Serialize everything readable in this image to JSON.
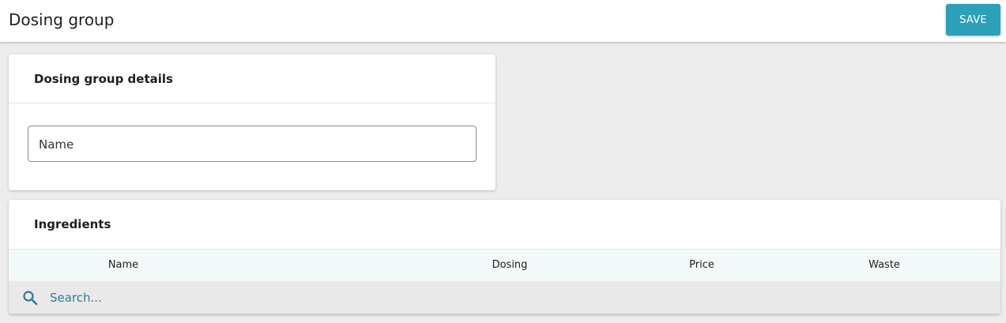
{
  "header": {
    "title": "Dosing group",
    "save_label": "SAVE"
  },
  "details": {
    "title": "Dosing group details",
    "name_field": {
      "label": "Name",
      "value": ""
    }
  },
  "ingredients": {
    "title": "Ingredients",
    "columns": [
      "Name",
      "Dosing",
      "Price",
      "Waste"
    ],
    "search": {
      "placeholder": "Search...",
      "value": ""
    },
    "rows": []
  },
  "colors": {
    "accent": "#2c9fb9",
    "background": "#ececec",
    "header_row": "#f3f8f8",
    "search_row": "#e9e9e9",
    "search_text": "#2a7f93"
  },
  "icons": {
    "search": "search-icon"
  }
}
